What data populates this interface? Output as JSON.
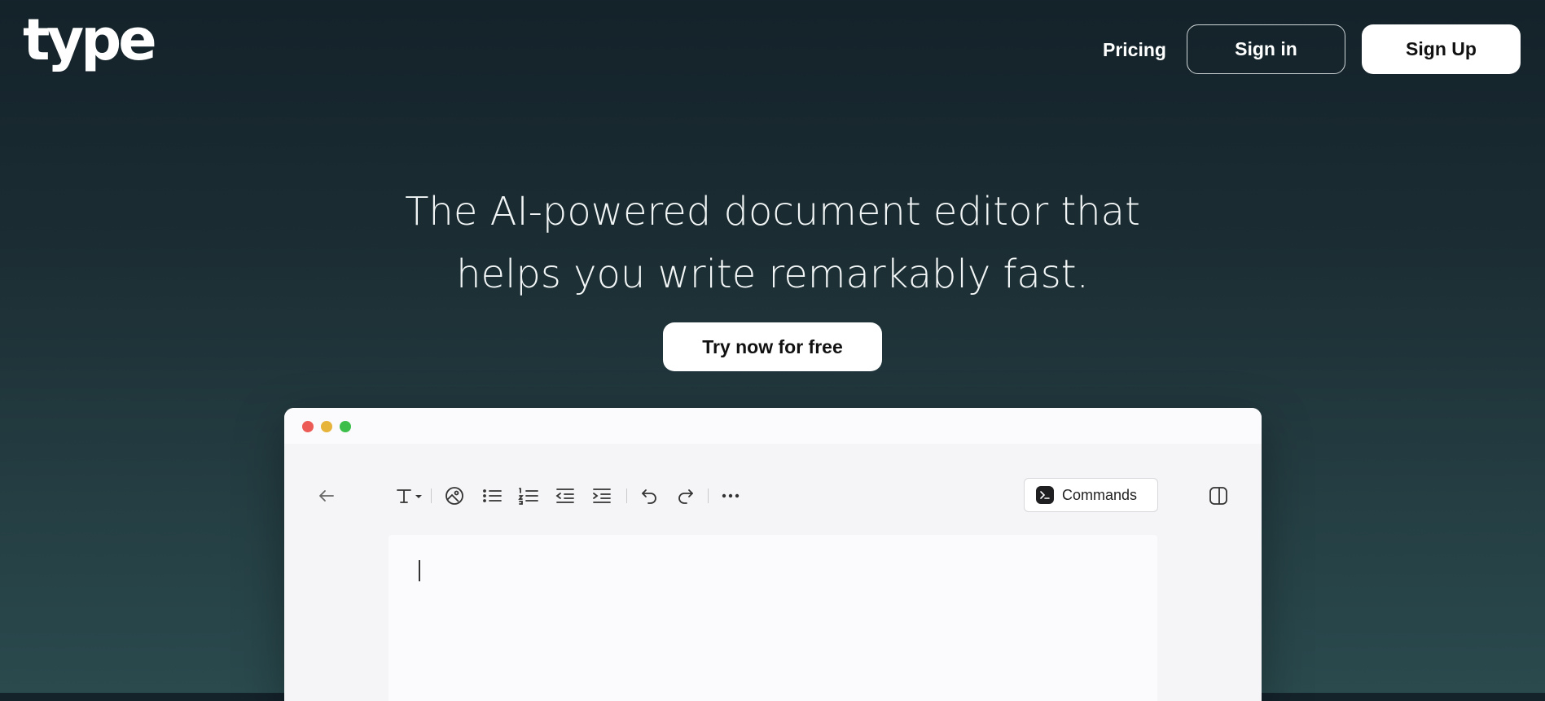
{
  "header": {
    "logo_text": "type",
    "nav_pricing": "Pricing",
    "sign_in_label": "Sign in",
    "sign_up_label": "Sign Up"
  },
  "hero": {
    "headline_line1": "The AI-powered document editor that",
    "headline_line2": "helps you write remarkably fast.",
    "cta_label": "Try now for free"
  },
  "editor_preview": {
    "window_controls": [
      "close",
      "minimize",
      "maximize"
    ],
    "toolbar_icons": [
      "back-arrow-icon",
      "text-style-icon",
      "image-icon",
      "bullet-list-icon",
      "numbered-list-icon",
      "outdent-icon",
      "indent-icon",
      "undo-icon",
      "redo-icon",
      "more-icon"
    ],
    "commands_label": "Commands",
    "sidebar_toggle_icon": "sidebar-toggle-icon"
  },
  "colors": {
    "background_top": "#14222a",
    "background_bottom": "#2a4a4e",
    "button_white": "#ffffff",
    "dot_red": "#ec5b56",
    "dot_yellow": "#e6b33b",
    "dot_green": "#3bbf4a"
  }
}
